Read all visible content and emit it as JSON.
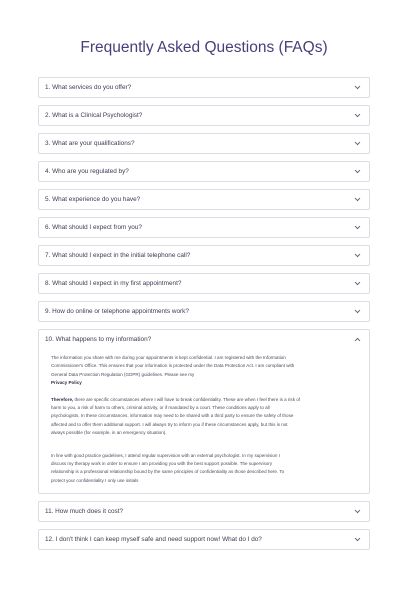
{
  "page": {
    "title": "Frequently Asked Questions (FAQs)"
  },
  "faqs": [
    {
      "question": "1. What services do you offer?"
    },
    {
      "question": "2. What is a Clinical Psychologist?"
    },
    {
      "question": "3. What are your qualifications?"
    },
    {
      "question": "4. Who are you regulated by?"
    },
    {
      "question": "5. What experience do you have?"
    },
    {
      "question": "6. What should I expect from you?"
    },
    {
      "question": "7. What should I expect in the initial telephone call?"
    },
    {
      "question": "8. What should I expect in my first appointment?"
    },
    {
      "question": "9. How do online or telephone appointments work?"
    },
    {
      "question": "10. What happens to my information?",
      "answer": {
        "p1_line1": "The information you share with me during your appointments is kept confidential. I am registered with the Information",
        "p1_line2": "Commissioner's Office. This ensures that your information is protected under the Data Protection Act. I am compliant with",
        "p1_line3": "General Data Protection Regulation (GDPR) guidelines. Please see my",
        "privacy_link": "Privacy Policy",
        "p2_lead": "Therefore,",
        "p2_line1": "there are specific circumstances where I will have to break confidentiality. These are when I feel there is a risk of",
        "p2_line2": "harm to you, a risk of harm to others, criminal activity, or if mandated by a court. These conditions apply to all",
        "p2_line3": "psychologists. In these circumstances, information may need to be shared with a third party to ensure the safety of those",
        "p2_line4": "affected and to offer them additional support. I will always try to inform you if these circumstances apply, but this is not",
        "p2_line5": "always possible (for example, in an emergency situation).",
        "p3_line1": "In line with good practice guidelines, I attend regular supervision with an external psychologist. In my supervision I",
        "p3_line2": "discuss my therapy work in order to ensure I am providing you with the best support possible. The supervisory",
        "p3_line3": "relationship is a professional relationship bound by the same principles of confidentiality as those described here. To",
        "p3_line4": "protect your confidentiality I only use initials"
      }
    },
    {
      "question": "11. How much does it cost?"
    },
    {
      "question": "12. I don't think I can keep myself safe and need support now! What do I do?"
    }
  ],
  "colors": {
    "title": "#4a3d7a",
    "border": "#dcdce4",
    "text": "#3b3b52"
  },
  "icons": {
    "collapsed": "chevron-down-icon",
    "expanded": "chevron-up-icon"
  }
}
